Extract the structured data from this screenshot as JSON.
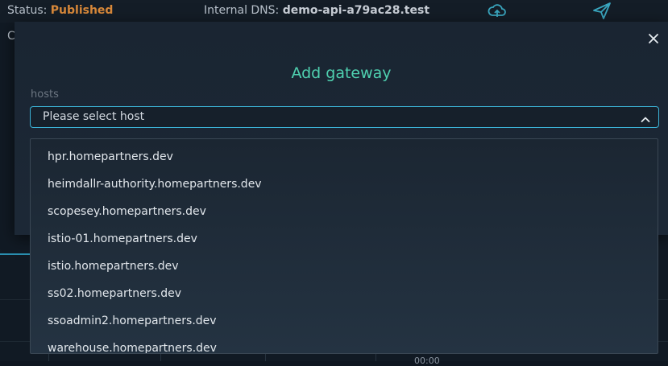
{
  "background": {
    "status_label": "Status: ",
    "status_value": "Published",
    "dns_label": "Internal DNS: ",
    "dns_value": "demo-api-a79ac28.test",
    "partial_text": "C",
    "bottom_partial": "00:00"
  },
  "modal": {
    "title": "Add gateway",
    "hosts_label": "hosts",
    "select_placeholder": "Please select host"
  },
  "dropdown": {
    "options": [
      "hpr.homepartners.dev",
      "heimdallr-authority.homepartners.dev",
      "scopesey.homepartners.dev",
      "istio-01.homepartners.dev",
      "istio.homepartners.dev",
      "ss02.homepartners.dev",
      "ssoadmin2.homepartners.dev",
      "warehouse.homepartners.dev"
    ]
  },
  "colors": {
    "accent": "#4fd1b0",
    "select_border": "#3bb2d6",
    "status_published": "#d9893a"
  },
  "icons": [
    "cloud-upload-icon",
    "send-icon",
    "close-icon",
    "chevron-up-icon"
  ]
}
